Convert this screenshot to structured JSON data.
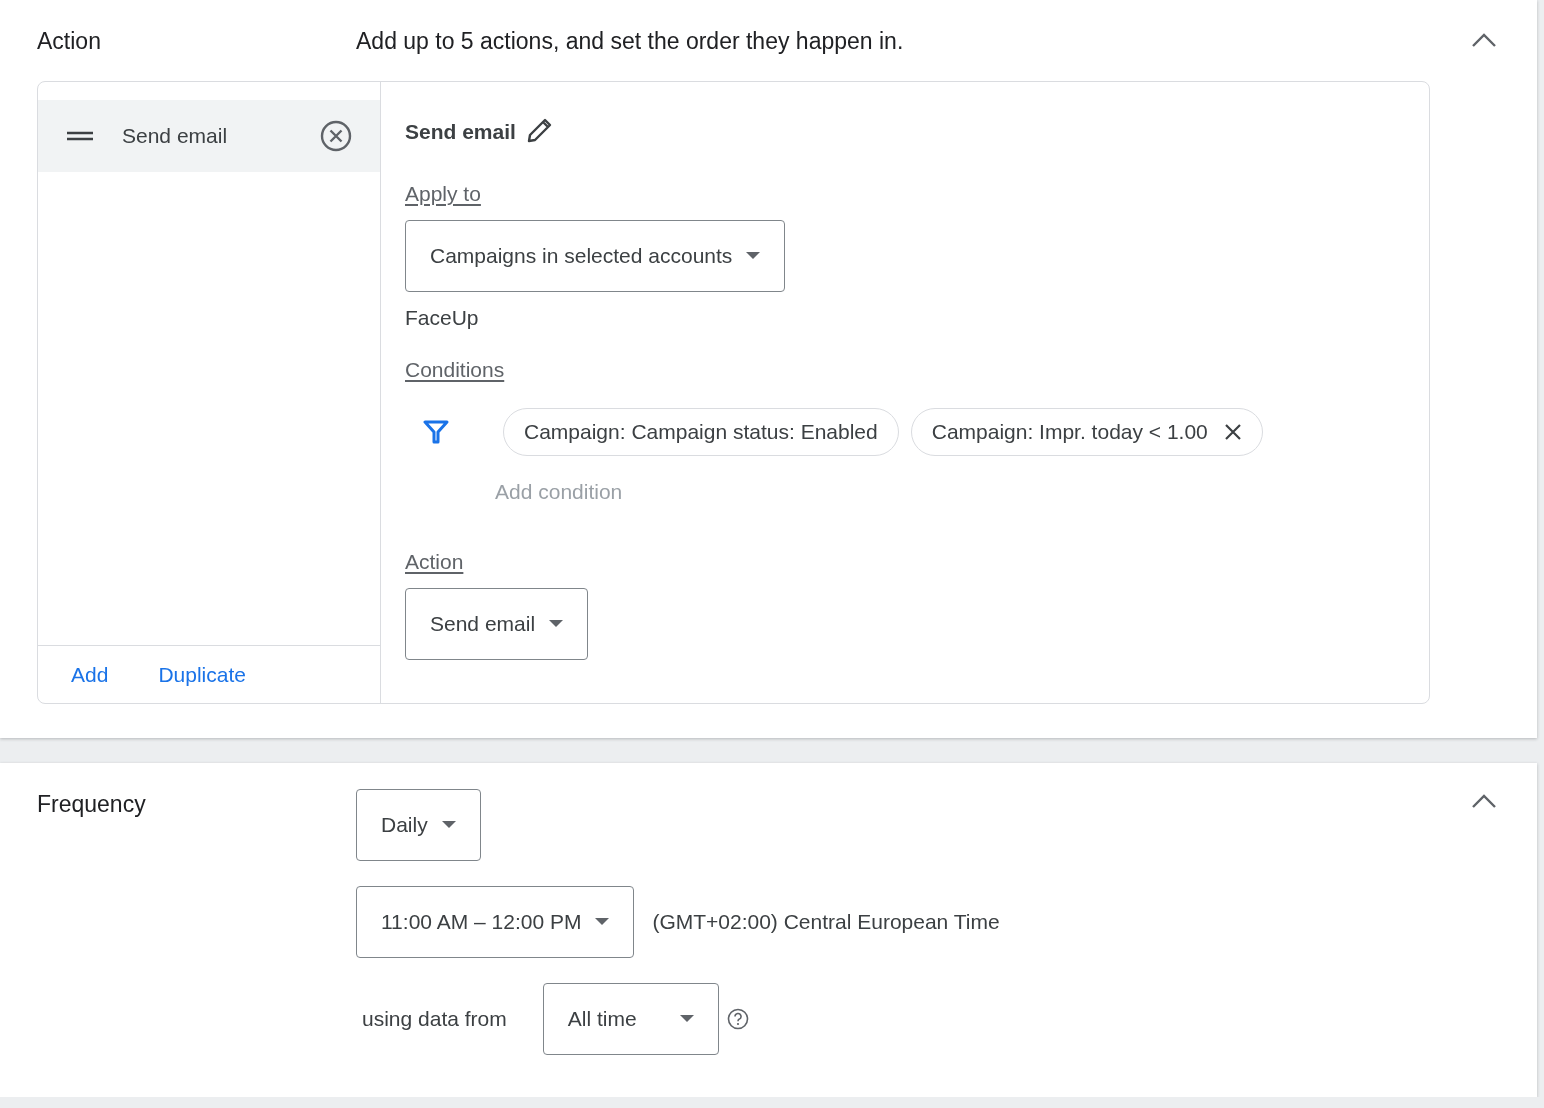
{
  "action_section": {
    "title": "Action",
    "description": "Add up to 5 actions, and set the order they happen in.",
    "expanded": true,
    "action_list": [
      {
        "label": "Send email",
        "selected": true
      }
    ],
    "list_buttons": [
      "Add",
      "Duplicate"
    ],
    "editor": {
      "title": "Send email",
      "apply_to_label": "Apply to",
      "apply_to": "Campaigns in selected accounts",
      "account": "FaceUp",
      "conditions_label": "Conditions",
      "conditions": [
        {
          "text": "Campaign: Campaign status: Enabled",
          "removable": false
        },
        {
          "text": "Campaign: Impr. today < 1.00",
          "removable": true
        }
      ],
      "add_condition": "Add condition",
      "action_label": "Action",
      "action": "Send email"
    }
  },
  "frequency_section": {
    "title": "Frequency",
    "expanded": true,
    "frequency": "Daily",
    "time_range": "11:00 AM – 12:00 PM",
    "timezone": "(GMT+02:00) Central European Time",
    "data_label": "using data from",
    "data_range": "All time"
  }
}
